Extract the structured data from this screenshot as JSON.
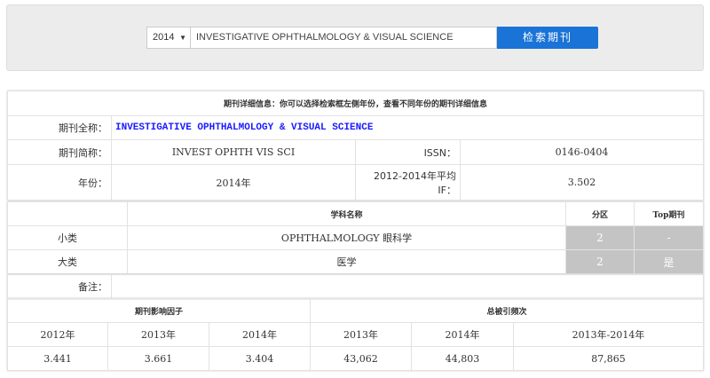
{
  "search": {
    "year": "2014",
    "query": "INVESTIGATIVE OPHTHALMOLOGY & VISUAL SCIENCE",
    "button": "检索期刊"
  },
  "info": {
    "header": "期刊详细信息：你可以选择检索框左侧年份，查看不同年份的期刊详细信息",
    "full_name_label": "期刊全称：",
    "full_name": "INVESTIGATIVE OPHTHALMOLOGY & VISUAL SCIENCE",
    "abbr_label": "期刊简称：",
    "abbr": "INVEST OPHTH VIS SCI",
    "issn_label": "ISSN：",
    "issn": "0146-0404",
    "year_label": "年份：",
    "year": "2014年",
    "avg_if_label": "2012-2014年平均IF：",
    "avg_if": "3.502"
  },
  "subjects": {
    "headers": [
      "",
      "学科名称",
      "分区",
      "Top期刊"
    ],
    "rows": [
      {
        "type": "小类",
        "name": "OPHTHALMOLOGY 眼科学",
        "zone": "2",
        "top": "-"
      },
      {
        "type": "大类",
        "name": "医学",
        "zone": "2",
        "top": "是"
      }
    ]
  },
  "notes": {
    "label": "备注：",
    "value": ""
  },
  "stats": {
    "if_header": "期刊影响因子",
    "cite_header": "总被引频次",
    "columns": [
      "2012年",
      "2013年",
      "2014年",
      "2013年",
      "2014年",
      "2013年-2014年"
    ],
    "values": [
      "3.441",
      "3.661",
      "3.404",
      "43,062",
      "44,803",
      "87,865"
    ]
  }
}
